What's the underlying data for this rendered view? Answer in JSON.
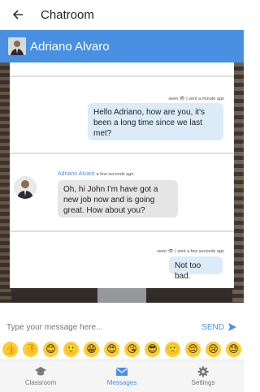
{
  "app": {
    "title": "Chatroom"
  },
  "chat": {
    "contact_name": "Adriano Alvaro"
  },
  "messages": [
    {
      "direction": "out",
      "meta": "seen 👁 | sent a minute ago",
      "text": "Hello Adriano, how are you, it's been a long time since we last met?"
    },
    {
      "direction": "in",
      "sender": "Adriano Alvaro",
      "ago": "a few seconds ago",
      "text": "Oh, hi John I'm have got a new job now and is going great. How about you?"
    },
    {
      "direction": "out",
      "meta": "seen 👁 | sent a few seconds ago",
      "text": "Not too bad."
    }
  ],
  "composer": {
    "placeholder": "Type your message here...",
    "send_label": "SEND"
  },
  "emojis": [
    "👍",
    "👎",
    "😊",
    "🙂",
    "😁",
    "😍",
    "😘",
    "😎",
    "🙁",
    "😔",
    "😢",
    "😓"
  ],
  "nav": [
    {
      "label": "Classroom",
      "icon": "graduation-cap-icon",
      "active": false
    },
    {
      "label": "Messages",
      "icon": "envelope-icon",
      "active": true
    },
    {
      "label": "Settings",
      "icon": "gear-icon",
      "active": false
    }
  ],
  "colors": {
    "primary": "#4a90e2",
    "outgoing_bubble": "#dcebf8",
    "incoming_bubble": "#e5e5e5"
  }
}
